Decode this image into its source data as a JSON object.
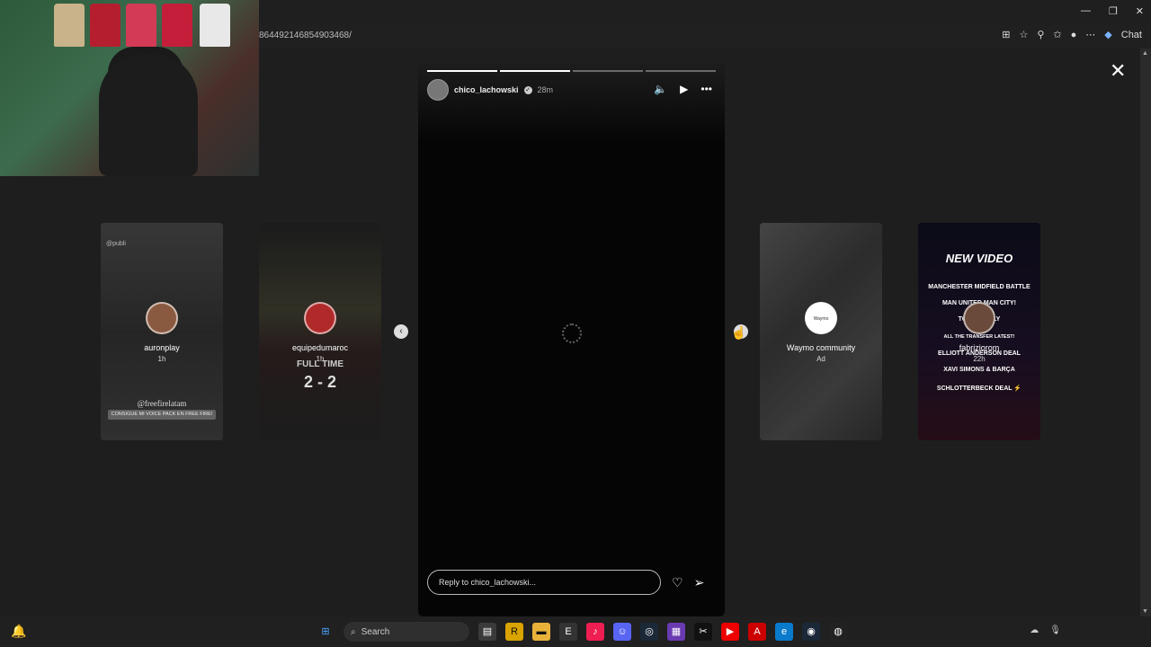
{
  "browser": {
    "url": "864492146854903468/",
    "chat_label": "Chat"
  },
  "story": {
    "username": "chico_lachowski",
    "time": "28m",
    "reply_placeholder": "Reply to chico_lachowski...",
    "progress_segments": 4,
    "progress_done": 2
  },
  "cards": [
    {
      "name": "auronplay",
      "time": "1h",
      "tag": "@freefirelatam",
      "banner": "CONSIGUE MI VOICE PACK EN FREE FIRE!",
      "watermark": "@publi"
    },
    {
      "name": "equipedumaroc",
      "time": "1h",
      "ft": "FULL TIME",
      "score": "2 - 2"
    },
    {
      "name": "Waymo community",
      "time": "Ad",
      "avatar_text": "Waymo community"
    },
    {
      "name": "fabriziorom",
      "time": "22h",
      "title": "NEW VIDEO",
      "lines": [
        "MANCHESTER MIDFIELD BATTLE",
        "MAN UNITED MAN CITY!",
        "TONALI ONLY",
        "ALL THE TRANSFER LATEST!",
        "ELLIOTT ANDERSON DEAL",
        "XAVI SIMONS & BARÇA",
        "SCHLOTTERBECK DEAL ⚡"
      ]
    }
  ],
  "taskbar": {
    "search_label": "Search"
  }
}
